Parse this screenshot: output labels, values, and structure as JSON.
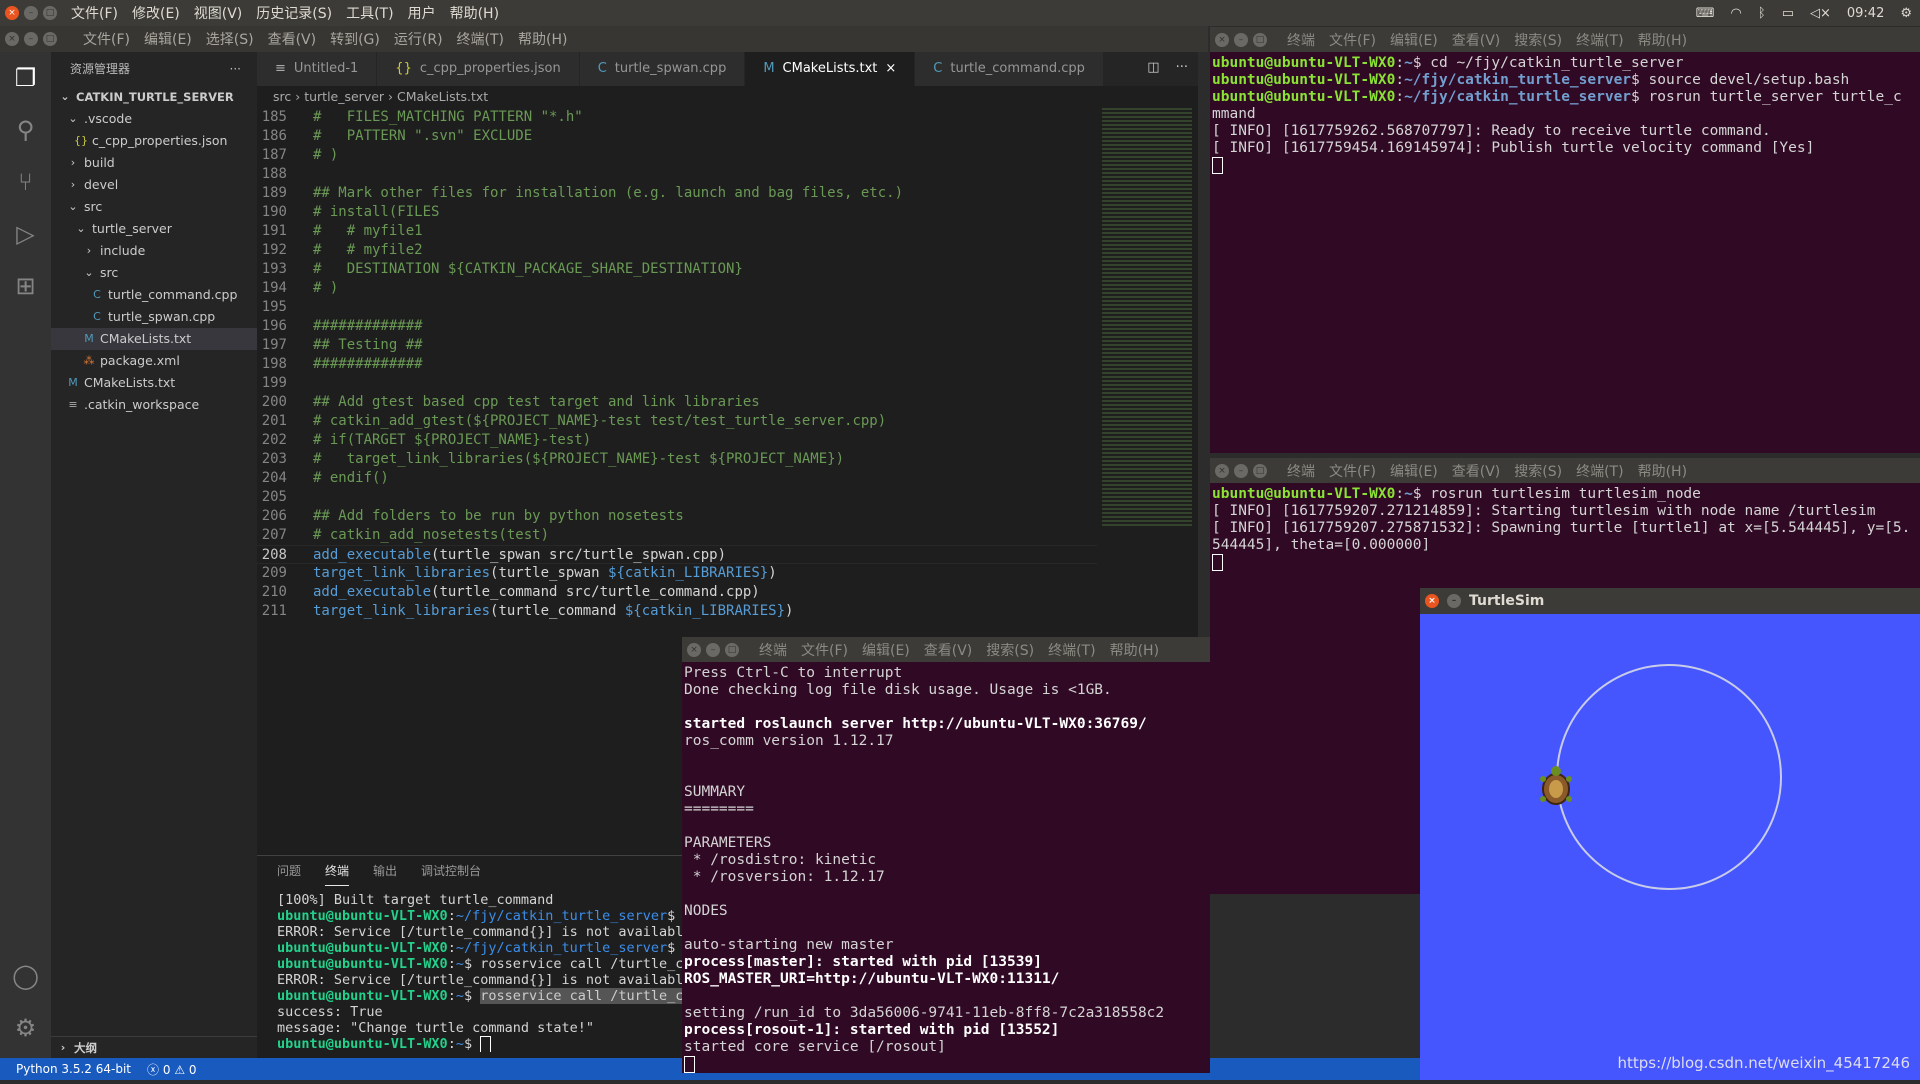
{
  "topbar": {
    "menu": [
      "文件(F)",
      "修改(E)",
      "视图(V)",
      "历史记录(S)",
      "工具(T)",
      "用户",
      "帮助(H)"
    ],
    "time": "09:42"
  },
  "vscode": {
    "menu": [
      "文件(F)",
      "编辑(E)",
      "选择(S)",
      "查看(V)",
      "转到(G)",
      "运行(R)",
      "终端(T)",
      "帮助(H)"
    ],
    "sidebar": {
      "title": "资源管理器",
      "more": "···",
      "root": "CATKIN_TURTLE_SERVER",
      "outline": "大纲",
      "items": [
        {
          "label": ".vscode",
          "depth": 1,
          "icon": "chevron-down"
        },
        {
          "label": "c_cpp_properties.json",
          "depth": 2,
          "icon": "json"
        },
        {
          "label": "build",
          "depth": 1,
          "icon": "chevron-right"
        },
        {
          "label": "devel",
          "depth": 1,
          "icon": "chevron-right"
        },
        {
          "label": "src",
          "depth": 1,
          "icon": "chevron-down"
        },
        {
          "label": "turtle_server",
          "depth": 2,
          "icon": "chevron-down"
        },
        {
          "label": "include",
          "depth": 3,
          "icon": "chevron-right"
        },
        {
          "label": "src",
          "depth": 3,
          "icon": "chevron-down"
        },
        {
          "label": "turtle_command.cpp",
          "depth": 4,
          "icon": "cpp"
        },
        {
          "label": "turtle_spwan.cpp",
          "depth": 4,
          "icon": "cpp"
        },
        {
          "label": "CMakeLists.txt",
          "depth": 3,
          "icon": "cmake",
          "selected": true
        },
        {
          "label": "package.xml",
          "depth": 3,
          "icon": "xml"
        },
        {
          "label": "CMakeLists.txt",
          "depth": 1,
          "icon": "cmake"
        },
        {
          "label": ".catkin_workspace",
          "depth": 1,
          "icon": "text"
        }
      ]
    },
    "tabs": [
      {
        "label": "Untitled-1",
        "icon": "≡"
      },
      {
        "label": "c_cpp_properties.json",
        "icon": "{}"
      },
      {
        "label": "turtle_spwan.cpp",
        "icon": "C"
      },
      {
        "label": "CMakeLists.txt",
        "icon": "M",
        "active": true,
        "close": "×"
      },
      {
        "label": "turtle_command.cpp",
        "icon": "C"
      }
    ],
    "breadcrumb": [
      "src",
      "turtle_server",
      "CMakeLists.txt"
    ],
    "current_line": "208",
    "code": [
      {
        "n": "185",
        "s": [
          {
            "t": "#   FILES_MATCHING PATTERN \"*.h\"",
            "k": "cm"
          }
        ]
      },
      {
        "n": "186",
        "s": [
          {
            "t": "#   PATTERN \".svn\" EXCLUDE",
            "k": "cm"
          }
        ]
      },
      {
        "n": "187",
        "s": [
          {
            "t": "# )",
            "k": "cm"
          }
        ]
      },
      {
        "n": "188",
        "s": []
      },
      {
        "n": "189",
        "s": [
          {
            "t": "## Mark other files for installation (e.g. launch and bag files, etc.)",
            "k": "cm"
          }
        ]
      },
      {
        "n": "190",
        "s": [
          {
            "t": "# install(FILES",
            "k": "cm"
          }
        ]
      },
      {
        "n": "191",
        "s": [
          {
            "t": "#   # myfile1",
            "k": "cm"
          }
        ]
      },
      {
        "n": "192",
        "s": [
          {
            "t": "#   # myfile2",
            "k": "cm"
          }
        ]
      },
      {
        "n": "193",
        "s": [
          {
            "t": "#   DESTINATION ${CATKIN_PACKAGE_SHARE_DESTINATION}",
            "k": "cm"
          }
        ]
      },
      {
        "n": "194",
        "s": [
          {
            "t": "# )",
            "k": "cm"
          }
        ]
      },
      {
        "n": "195",
        "s": []
      },
      {
        "n": "196",
        "s": [
          {
            "t": "#############",
            "k": "cm"
          }
        ]
      },
      {
        "n": "197",
        "s": [
          {
            "t": "## Testing ##",
            "k": "cm"
          }
        ]
      },
      {
        "n": "198",
        "s": [
          {
            "t": "#############",
            "k": "cm"
          }
        ]
      },
      {
        "n": "199",
        "s": []
      },
      {
        "n": "200",
        "s": [
          {
            "t": "## Add gtest based cpp test target and link libraries",
            "k": "cm"
          }
        ]
      },
      {
        "n": "201",
        "s": [
          {
            "t": "# catkin_add_gtest(${PROJECT_NAME}-test test/test_turtle_server.cpp)",
            "k": "cm"
          }
        ]
      },
      {
        "n": "202",
        "s": [
          {
            "t": "# if(TARGET ${PROJECT_NAME}-test)",
            "k": "cm"
          }
        ]
      },
      {
        "n": "203",
        "s": [
          {
            "t": "#   target_link_libraries(${PROJECT_NAME}-test ${PROJECT_NAME})",
            "k": "cm"
          }
        ]
      },
      {
        "n": "204",
        "s": [
          {
            "t": "# endif()",
            "k": "cm"
          }
        ]
      },
      {
        "n": "205",
        "s": []
      },
      {
        "n": "206",
        "s": [
          {
            "t": "## Add folders to be run by python nosetests",
            "k": "cm"
          }
        ]
      },
      {
        "n": "207",
        "s": [
          {
            "t": "# catkin_add_nosetests(test)",
            "k": "cm"
          }
        ]
      },
      {
        "n": "208",
        "s": [
          {
            "t": "add_executable",
            "k": "kw"
          },
          {
            "t": "(turtle_spwan src/turtle_spwan.cpp)",
            "k": "pl"
          }
        ]
      },
      {
        "n": "209",
        "s": [
          {
            "t": "target_link_libraries",
            "k": "kw"
          },
          {
            "t": "(turtle_spwan ",
            "k": "pl"
          },
          {
            "t": "${catkin_LIBRARIES}",
            "k": "var"
          },
          {
            "t": ")",
            "k": "pl"
          }
        ]
      },
      {
        "n": "210",
        "s": [
          {
            "t": "add_executable",
            "k": "kw"
          },
          {
            "t": "(turtle_command src/turtle_command.cpp)",
            "k": "pl"
          }
        ]
      },
      {
        "n": "211",
        "s": [
          {
            "t": "target_link_libraries",
            "k": "kw"
          },
          {
            "t": "(turtle_command ",
            "k": "pl"
          },
          {
            "t": "${catkin_LIBRARIES}",
            "k": "var"
          },
          {
            "t": ")",
            "k": "pl"
          }
        ]
      }
    ],
    "panel": {
      "tabs": [
        "问题",
        "终端",
        "输出",
        "调试控制台"
      ],
      "active": 1,
      "lines": [
        [
          {
            "t": "[100%] Built target turtle_command",
            "k": "pl"
          }
        ],
        [
          {
            "t": "ubuntu@ubuntu-VLT-WX0",
            "k": "user"
          },
          {
            "t": ":",
            "k": "pl"
          },
          {
            "t": "~/fjy/catkin_turtle_server",
            "k": "path"
          },
          {
            "t": "$ r",
            "k": "pl"
          }
        ],
        [
          {
            "t": "ERROR: Service [/turtle_command{}] is not available",
            "k": "pl"
          }
        ],
        [
          {
            "t": "ubuntu@ubuntu-VLT-WX0",
            "k": "user"
          },
          {
            "t": ":",
            "k": "pl"
          },
          {
            "t": "~/fjy/catkin_turtle_server",
            "k": "path"
          },
          {
            "t": "$ c",
            "k": "pl"
          }
        ],
        [
          {
            "t": "ubuntu@ubuntu-VLT-WX0",
            "k": "user"
          },
          {
            "t": ":",
            "k": "pl"
          },
          {
            "t": "~",
            "k": "path"
          },
          {
            "t": "$ rosservice call /turtle_co",
            "k": "pl"
          }
        ],
        [
          {
            "t": "ERROR: Service [/turtle_command{}] is not available",
            "k": "pl"
          }
        ],
        [
          {
            "t": "ubuntu@ubuntu-VLT-WX0",
            "k": "user"
          },
          {
            "t": ":",
            "k": "pl"
          },
          {
            "t": "~",
            "k": "path"
          },
          {
            "t": "$ ",
            "k": "pl"
          },
          {
            "t": "rosservice call /turtle_co",
            "k": "sel"
          }
        ],
        [
          {
            "t": "success: True",
            "k": "pl"
          }
        ],
        [
          {
            "t": "message: \"Change turtle command state!\"",
            "k": "pl"
          }
        ],
        [
          {
            "t": "ubuntu@ubuntu-VLT-WX0",
            "k": "user"
          },
          {
            "t": ":",
            "k": "pl"
          },
          {
            "t": "~",
            "k": "path"
          },
          {
            "t": "$ ",
            "k": "pl"
          },
          {
            "t": "",
            "k": "cursor"
          }
        ]
      ]
    },
    "status": {
      "python": "Python 3.5.2 64-bit",
      "errors": "0",
      "warnings": "0"
    }
  },
  "terminal_menu": [
    "终端",
    "文件(F)",
    "编辑(E)",
    "查看(V)",
    "搜索(S)",
    "终端(T)",
    "帮助(H)"
  ],
  "term_server": [
    [
      {
        "t": "ubuntu@ubuntu-VLT-WX0",
        "k": "user"
      },
      {
        "t": ":",
        "k": "pl"
      },
      {
        "t": "~",
        "k": "path"
      },
      {
        "t": "$ cd ~/fjy/catkin_turtle_server",
        "k": "pl"
      }
    ],
    [
      {
        "t": "ubuntu@ubuntu-VLT-WX0",
        "k": "user"
      },
      {
        "t": ":",
        "k": "pl"
      },
      {
        "t": "~/fjy/catkin_turtle_server",
        "k": "path"
      },
      {
        "t": "$ source devel/setup.bash",
        "k": "pl"
      }
    ],
    [
      {
        "t": "ubuntu@ubuntu-VLT-WX0",
        "k": "user"
      },
      {
        "t": ":",
        "k": "pl"
      },
      {
        "t": "~/fjy/catkin_turtle_server",
        "k": "path"
      },
      {
        "t": "$ rosrun turtle_server turtle_c",
        "k": "pl"
      }
    ],
    [
      {
        "t": "mmand",
        "k": "pl"
      }
    ],
    [
      {
        "t": "[ INFO] [1617759262.568707797]: Ready to receive turtle command.",
        "k": "pl"
      }
    ],
    [
      {
        "t": "[ INFO] [1617759454.169145974]: Publish turtle velocity command [Yes]",
        "k": "pl"
      }
    ],
    [
      {
        "t": "",
        "k": "cursor"
      }
    ]
  ],
  "term_turtlesim": [
    [
      {
        "t": "ubuntu@ubuntu-VLT-WX0",
        "k": "user"
      },
      {
        "t": ":",
        "k": "pl"
      },
      {
        "t": "~",
        "k": "path"
      },
      {
        "t": "$ rosrun turtlesim turtlesim_node",
        "k": "pl"
      }
    ],
    [
      {
        "t": "[ INFO] [1617759207.271214859]: Starting turtlesim with node name /turtlesim",
        "k": "pl"
      }
    ],
    [
      {
        "t": "[ INFO] [1617759207.275871532]: Spawning turtle [turtle1] at x=[5.544445], y=[5.",
        "k": "pl"
      }
    ],
    [
      {
        "t": "544445], theta=[0.000000]",
        "k": "pl"
      }
    ],
    [
      {
        "t": "",
        "k": "cursor"
      }
    ]
  ],
  "term_roslaunch": [
    [
      {
        "t": "Press Ctrl-C to interrupt",
        "k": "pl"
      }
    ],
    [
      {
        "t": "Done checking log file disk usage. Usage is <1GB.",
        "k": "pl"
      }
    ],
    [],
    [
      {
        "t": "started roslaunch server http://ubuntu-VLT-WX0:36769/",
        "k": "b"
      }
    ],
    [
      {
        "t": "ros_comm version 1.12.17",
        "k": "pl"
      }
    ],
    [],
    [],
    [
      {
        "t": "SUMMARY",
        "k": "pl"
      }
    ],
    [
      {
        "t": "========",
        "k": "pl"
      }
    ],
    [],
    [
      {
        "t": "PARAMETERS",
        "k": "pl"
      }
    ],
    [
      {
        "t": " * /rosdistro: kinetic",
        "k": "pl"
      }
    ],
    [
      {
        "t": " * /rosversion: 1.12.17",
        "k": "pl"
      }
    ],
    [],
    [
      {
        "t": "NODES",
        "k": "pl"
      }
    ],
    [],
    [
      {
        "t": "auto-starting new master",
        "k": "pl"
      }
    ],
    [
      {
        "t": "process[master]: started with pid [13539]",
        "k": "b"
      }
    ],
    [
      {
        "t": "ROS_MASTER_URI=http://ubuntu-VLT-WX0:11311/",
        "k": "b"
      }
    ],
    [],
    [
      {
        "t": "setting /run_id to 3da56006-9741-11eb-8ff8-7c2a318558c2",
        "k": "pl"
      }
    ],
    [
      {
        "t": "process[rosout-1]: started with pid [13552]",
        "k": "b"
      }
    ],
    [
      {
        "t": "started core service [/rosout]",
        "k": "pl"
      }
    ],
    [
      {
        "t": "",
        "k": "cursor"
      }
    ]
  ],
  "turtlesim": {
    "title": "TurtleSim",
    "background": "#4556ff"
  },
  "watermark": "https://blog.csdn.net/weixin_45417246"
}
